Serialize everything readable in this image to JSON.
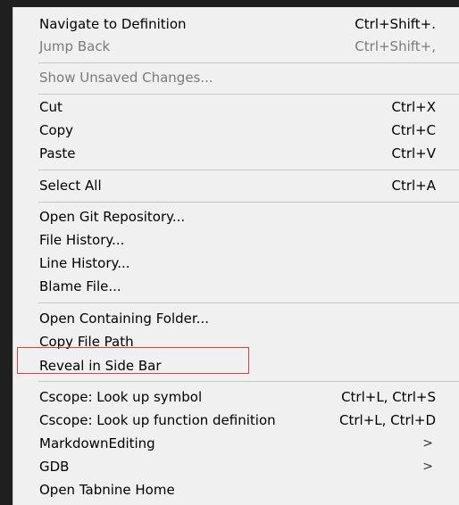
{
  "menu": {
    "items": [
      {
        "label": "Navigate to Definition",
        "shortcut": "Ctrl+Shift+.",
        "disabled": false
      },
      {
        "label": "Jump Back",
        "shortcut": "Ctrl+Shift+,",
        "disabled": true
      },
      {
        "label": "Show Unsaved Changes...",
        "shortcut": "",
        "disabled": true
      },
      {
        "label": "Cut",
        "shortcut": "Ctrl+X",
        "disabled": false
      },
      {
        "label": "Copy",
        "shortcut": "Ctrl+C",
        "disabled": false
      },
      {
        "label": "Paste",
        "shortcut": "Ctrl+V",
        "disabled": false
      },
      {
        "label": "Select All",
        "shortcut": "Ctrl+A",
        "disabled": false
      },
      {
        "label": "Open Git Repository...",
        "shortcut": "",
        "disabled": false
      },
      {
        "label": "File History...",
        "shortcut": "",
        "disabled": false
      },
      {
        "label": "Line History...",
        "shortcut": "",
        "disabled": false
      },
      {
        "label": "Blame File...",
        "shortcut": "",
        "disabled": false
      },
      {
        "label": "Open Containing Folder...",
        "shortcut": "",
        "disabled": false
      },
      {
        "label": "Copy File Path",
        "shortcut": "",
        "disabled": false
      },
      {
        "label": "Reveal in Side Bar",
        "shortcut": "",
        "disabled": false
      },
      {
        "label": "Cscope: Look up symbol",
        "shortcut": "Ctrl+L, Ctrl+S",
        "disabled": false
      },
      {
        "label": "Cscope: Look up function definition",
        "shortcut": "Ctrl+L, Ctrl+D",
        "disabled": false
      },
      {
        "label": "MarkdownEditing",
        "shortcut": "",
        "submenu": true,
        "disabled": false
      },
      {
        "label": "GDB",
        "shortcut": "",
        "submenu": true,
        "disabled": false
      },
      {
        "label": "Open Tabnine Home",
        "shortcut": "",
        "disabled": false
      }
    ],
    "submenu_arrow": ">"
  },
  "colors": {
    "menu_background": "#f0f0f0",
    "text": "#000000",
    "disabled_text": "#7a7a7a",
    "separator": "#c6c6c6",
    "highlight_border": "#e03c3c"
  }
}
